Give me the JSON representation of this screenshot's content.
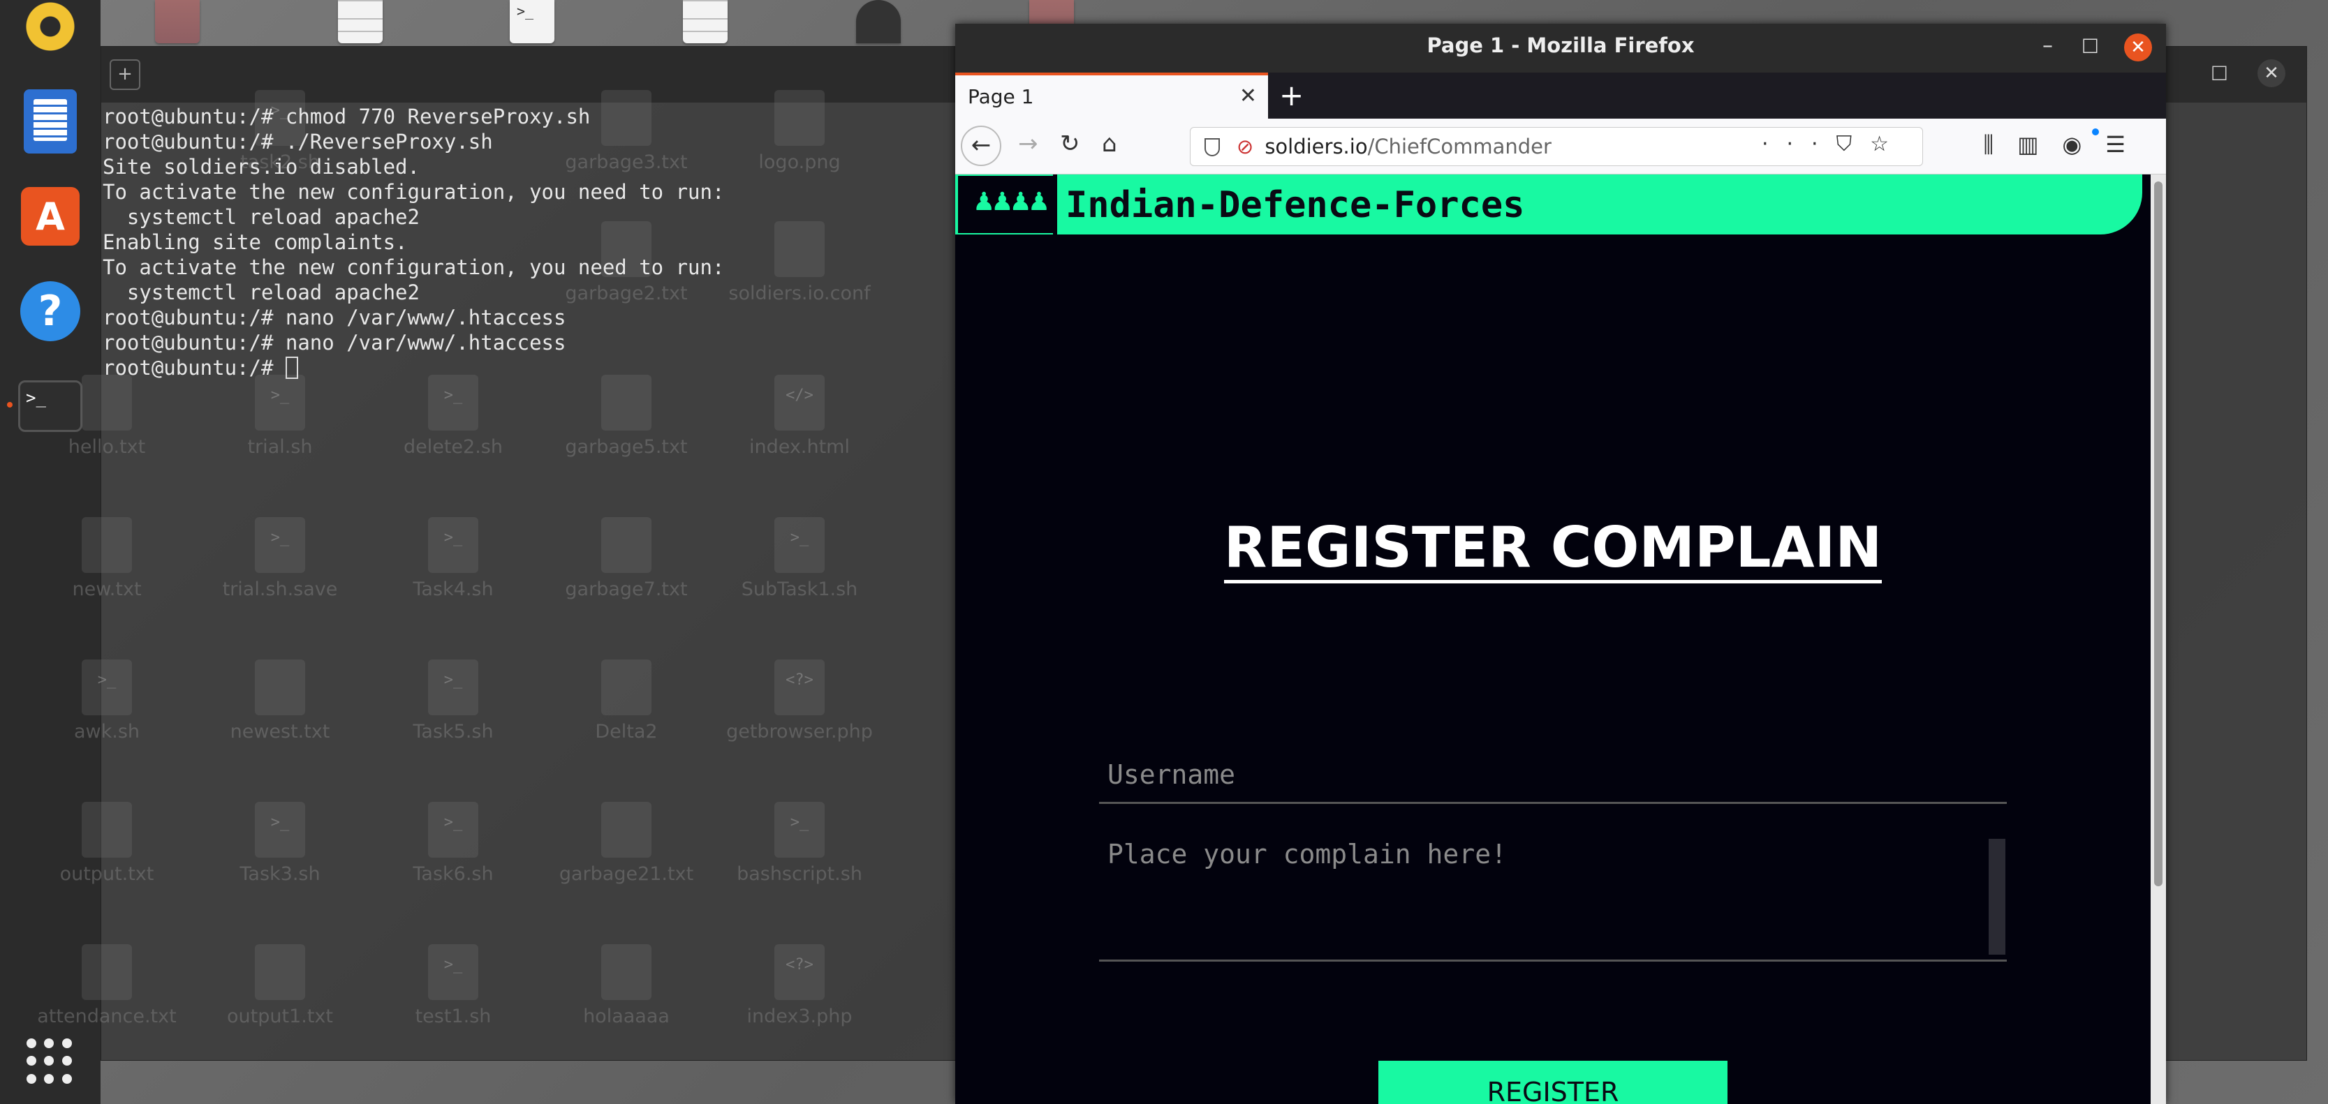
{
  "terminal": {
    "lines": [
      "root@ubuntu:/# chmod 770 ReverseProxy.sh",
      "root@ubuntu:/# ./ReverseProxy.sh",
      "Site soldiers.io disabled.",
      "To activate the new configuration, you need to run:",
      "  systemctl reload apache2",
      "Enabling site complaints.",
      "To activate the new configuration, you need to run:",
      "  systemctl reload apache2",
      "root@ubuntu:/# nano /var/www/.htaccess",
      "root@ubuntu:/# nano /var/www/.htaccess"
    ],
    "prompt": "root@ubuntu:/# "
  },
  "desktop_icons": [
    {
      "label": "task2.sh",
      "glyph": ">_"
    },
    {
      "label": "garbage3.txt",
      "glyph": ""
    },
    {
      "label": "logo.png",
      "glyph": ""
    },
    {
      "label": "garbage2.txt",
      "glyph": ""
    },
    {
      "label": "soldiers.io.conf",
      "glyph": ""
    },
    {
      "label": "hello.txt",
      "glyph": ""
    },
    {
      "label": "trial.sh",
      "glyph": ">_"
    },
    {
      "label": "delete2.sh",
      "glyph": ">_"
    },
    {
      "label": "garbage5.txt",
      "glyph": ""
    },
    {
      "label": "index.html",
      "glyph": "</>"
    },
    {
      "label": "new.txt",
      "glyph": ""
    },
    {
      "label": "trial.sh.save",
      "glyph": ">_"
    },
    {
      "label": "Task4.sh",
      "glyph": ">_"
    },
    {
      "label": "garbage7.txt",
      "glyph": ""
    },
    {
      "label": "SubTask1.sh",
      "glyph": ">_"
    },
    {
      "label": "awk.sh",
      "glyph": ">_"
    },
    {
      "label": "newest.txt",
      "glyph": ""
    },
    {
      "label": "Task5.sh",
      "glyph": ">_"
    },
    {
      "label": "Delta2",
      "glyph": ""
    },
    {
      "label": "getbrowser.php",
      "glyph": "<?>"
    },
    {
      "label": "output.txt",
      "glyph": ""
    },
    {
      "label": "Task3.sh",
      "glyph": ">_"
    },
    {
      "label": "Task6.sh",
      "glyph": ">_"
    },
    {
      "label": "garbage21.txt",
      "glyph": ""
    },
    {
      "label": "bashscript.sh",
      "glyph": ">_"
    },
    {
      "label": "attendance.txt",
      "glyph": ""
    },
    {
      "label": "output1.txt",
      "glyph": ""
    },
    {
      "label": "test1.sh",
      "glyph": ">_"
    },
    {
      "label": "holaaaaa",
      "glyph": ""
    },
    {
      "label": "index3.php",
      "glyph": "<?>"
    }
  ],
  "firefox": {
    "window_title": "Page 1 - Mozilla Firefox",
    "tab_label": "Page 1",
    "url_domain": "soldiers.io",
    "url_path": "/ChiefCommander"
  },
  "page": {
    "site_name": "Indian-Defence-Forces",
    "heading": "REGISTER COMPLAIN",
    "username_placeholder": "Username",
    "complaint_placeholder": "Place your complain here!",
    "register_label": "REGISTER"
  },
  "colors": {
    "accent": "#18f9a2",
    "page_bg": "#02020d",
    "ubuntu_orange": "#e95420"
  }
}
